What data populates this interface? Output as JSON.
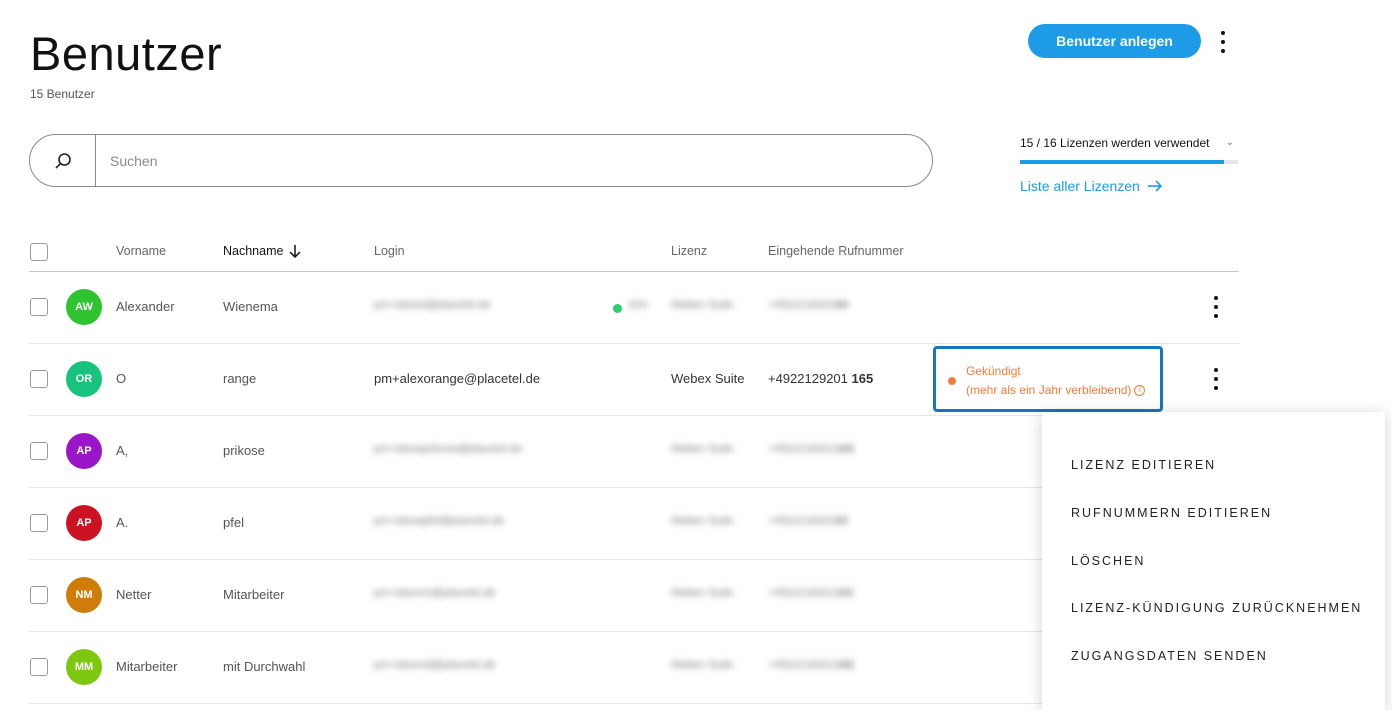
{
  "header": {
    "title": "Benutzer",
    "subtitle": "15 Benutzer",
    "create_button": "Benutzer anlegen"
  },
  "search": {
    "placeholder": "Suchen",
    "value": ""
  },
  "licenses": {
    "usage_text": "15 / 16 Lizenzen werden verwendet",
    "used": 15,
    "total": 16,
    "link_text": "Liste aller Lizenzen"
  },
  "table": {
    "columns": [
      "Vorname",
      "Nachname",
      "Login",
      "Lizenz",
      "Eingehende Rufnummer"
    ],
    "rows": [
      {
        "initials": "AW",
        "color": "#2fc32f",
        "first": "Alexander",
        "last": "Wienema",
        "login": "pm+alexwi@placetel.de",
        "badge": "ZEN",
        "license": "Webex Suite",
        "phone": "+4922129201",
        "ext": "64",
        "blurred": true
      },
      {
        "initials": "OR",
        "color": "#19c37d",
        "first": "O",
        "last": "range",
        "login": "pm+alexorange@placetel.de",
        "license": "Webex Suite",
        "phone": "+4922129201",
        "ext": "165",
        "blurred": false
      },
      {
        "initials": "AP",
        "color": "#9b16c6",
        "first": "A,",
        "last": "prikose",
        "login": "pm+alexaprikose@placetel.de",
        "license": "Webex Suite",
        "phone": "+4922129201",
        "ext": "163",
        "blurred": true
      },
      {
        "initials": "AP",
        "color": "#cc1122",
        "first": "A.",
        "last": "pfel",
        "login": "pm+alexapfel@placetel.de",
        "license": "Webex Suite",
        "phone": "+4922129201",
        "ext": "63",
        "blurred": true
      },
      {
        "initials": "NM",
        "color": "#d07c0a",
        "first": "Netter",
        "last": "Mitarbeiter",
        "login": "pm+alexnm@placetel.de",
        "license": "Webex Suite",
        "phone": "+4922129201",
        "ext": "161",
        "blurred": true
      },
      {
        "initials": "MM",
        "color": "#7dc80f",
        "first": "Mitarbeiter",
        "last": "mit Durchwahl",
        "login": "pm+alexmd@placetel.de",
        "license": "Webex Suite",
        "phone": "+4922129201",
        "ext": "162",
        "blurred": true
      }
    ]
  },
  "status": {
    "line1": "Gekündigt",
    "line2": "(mehr als ein Jahr verbleibend)",
    "info_glyph": "i",
    "color": "#f07d3c"
  },
  "context_menu": {
    "items": [
      "LIZENZ EDITIEREN",
      "RUFNUMMERN EDITIEREN",
      "LÖSCHEN",
      "LIZENZ-KÜNDIGUNG ZURÜCKNEHMEN",
      "ZUGANGSDATEN SENDEN"
    ]
  },
  "icons": {
    "search": "search-icon",
    "sort": "arrow-down-icon",
    "link_arrow": "arrow-right-icon",
    "more": "kebab-icon",
    "dropdown": "chevron-down-icon"
  },
  "theme": {
    "accent": "#1d9be6",
    "focus": "#1776bd"
  }
}
